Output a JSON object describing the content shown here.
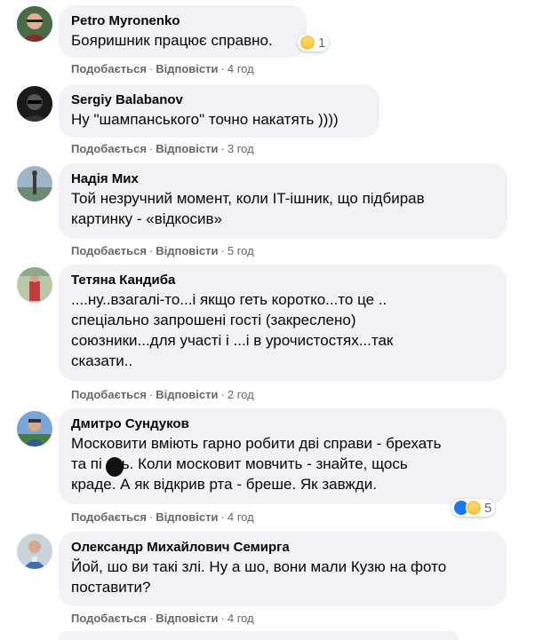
{
  "actions": {
    "like": "Подобається",
    "reply": "Відповісти",
    "sep": "·"
  },
  "comments": [
    {
      "author": "Petro Myronenko",
      "lines": [
        "Бояришник працює справно."
      ],
      "time": "4 год",
      "reaction_count": "1",
      "reactions": [
        "haha-icon"
      ]
    },
    {
      "author": "Sergiy Balabanov",
      "lines": [
        "Ну \"шампанського\" точно накатять ))))"
      ],
      "time": "3 год"
    },
    {
      "author": "Надія Мих",
      "lines": [
        "Той незручний момент, коли IT-ішник, що підбирав",
        "картинку - «відкосив»"
      ],
      "time": "5 год"
    },
    {
      "author": "Тетяна Кандиба",
      "lines": [
        "....ну..взагалі-то...і якщо геть коротко...то це ..",
        "спеціально запрошені гості (закреслено)",
        "союзники...для участі і ...і в урочистостях...так",
        "сказати.."
      ],
      "time": "2 год"
    },
    {
      "author": "Дмитро Сундуков",
      "lines": [
        "Московити вміють гарно робити дві справи - брехать",
        "та пі  ить. Коли московит мовчить - знайте, щось",
        "краде. А як відкрив рта - бреше. Як завжди."
      ],
      "time": "4 год",
      "reaction_count": "5",
      "reactions": [
        "like-icon",
        "haha-icon"
      ]
    },
    {
      "author": "Олександр Михайлович Семирга",
      "lines": [
        "Йой, шо ви такі злі. Ну а шо, вони мали Кузю на фото",
        "поставити?"
      ],
      "time": "4 год"
    }
  ],
  "colors": {
    "bubble": "#f0f2f5",
    "meta": "#65676b",
    "like_blue": "#1877f2",
    "haha_yellow": "#f7b125"
  }
}
